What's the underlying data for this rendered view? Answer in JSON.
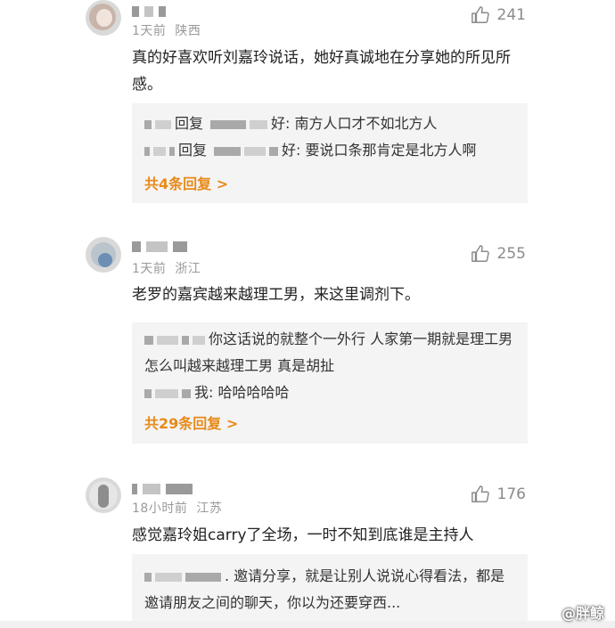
{
  "comments": [
    {
      "meta_time": "1天前",
      "meta_location": "陕西",
      "likes": "241",
      "text": "真的好喜欢听刘嘉玲说话，她好真诚地在分享她的所见所感。",
      "replies": [
        {
          "prefix": "回复",
          "tail": "好: 南方人口才不如北方人"
        },
        {
          "prefix": "回复",
          "tail": "好: 要说口条那肯定是北方人啊"
        }
      ],
      "more": "共4条回复 >"
    },
    {
      "meta_time": "1天前",
      "meta_location": "浙江",
      "likes": "255",
      "text": "老罗的嘉宾越来越理工男，来这里调剂下。",
      "replies": [
        {
          "prefix": "",
          "tail": "你这话说的就整个一外行 人家第一期就是理工男 怎么叫越来越理工男 真是胡扯"
        },
        {
          "prefix": "",
          "tail": "我: 哈哈哈哈哈"
        }
      ],
      "more": "共29条回复 >"
    },
    {
      "meta_time": "18小时前",
      "meta_location": "江苏",
      "likes": "176",
      "text": "感觉嘉玲姐carry了全场，一时不知到底谁是主持人",
      "replies": [
        {
          "prefix": "",
          "tail": ". 邀请分享，就是让别人说说心得看法，都是邀请朋友之间的聊天，你以为还要穿西..."
        }
      ],
      "more": ""
    }
  ],
  "watermark": "@胖鲸",
  "colors": {
    "more_link": "#e88a1a",
    "reply_bg": "#f4f4f4",
    "meta": "#9a9a9a"
  },
  "icons": {
    "like": "thumbs-up-icon"
  }
}
